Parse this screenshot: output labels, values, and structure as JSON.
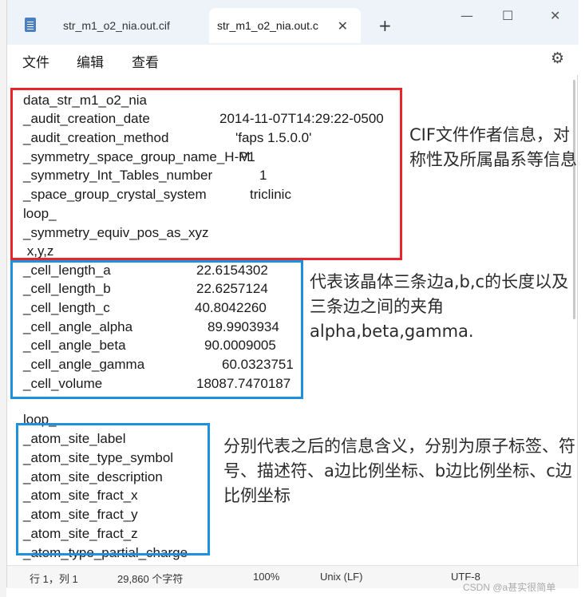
{
  "window": {
    "tabs": [
      {
        "label": "str_m1_o2_nia.out.cif"
      },
      {
        "label": "str_m1_o2_nia.out.c"
      }
    ],
    "new_tab_symbol": "+",
    "tab_close_symbol": "✕",
    "controls": {
      "minimize": "—",
      "maximize": "☐",
      "close": "✕"
    }
  },
  "menu": {
    "items": [
      "文件",
      "编辑",
      "查看"
    ],
    "settings_icon": "gear-icon"
  },
  "editor": {
    "lines": [
      {
        "key": "data_str_m1_o2_nia",
        "value": ""
      },
      {
        "key": "_audit_creation_date",
        "value": "2014-11-07T14:29:22-0500"
      },
      {
        "key": "_audit_creation_method",
        "value": "'faps 1.5.0.0'"
      },
      {
        "key": "_symmetry_space_group_name_H-M",
        "value": "P1"
      },
      {
        "key": "_symmetry_Int_Tables_number",
        "value": "1"
      },
      {
        "key": "_space_group_crystal_system",
        "value": "triclinic"
      },
      {
        "key": "loop_",
        "value": ""
      },
      {
        "key": "_symmetry_equiv_pos_as_xyz",
        "value": ""
      },
      {
        "key": " x,y,z",
        "value": ""
      },
      {
        "key": "_cell_length_a",
        "value": "22.6154302"
      },
      {
        "key": "_cell_length_b",
        "value": "22.6257124"
      },
      {
        "key": "_cell_length_c",
        "value": "40.8042260"
      },
      {
        "key": "_cell_angle_alpha",
        "value": "89.9903934"
      },
      {
        "key": "_cell_angle_beta",
        "value": "90.0009005"
      },
      {
        "key": "_cell_angle_gamma",
        "value": "60.0323751"
      },
      {
        "key": "_cell_volume",
        "value": "18087.7470187"
      },
      {
        "key": "loop_",
        "value": ""
      },
      {
        "key": "_atom_site_label",
        "value": ""
      },
      {
        "key": "_atom_site_type_symbol",
        "value": ""
      },
      {
        "key": "_atom_site_description",
        "value": ""
      },
      {
        "key": "_atom_site_fract_x",
        "value": ""
      },
      {
        "key": "_atom_site_fract_y",
        "value": ""
      },
      {
        "key": "_atom_site_fract_z",
        "value": ""
      },
      {
        "key": "_atom_type_partial_charge",
        "value": ""
      }
    ]
  },
  "annotations": {
    "red": "CIF文件作者信息，对称性及所属晶系等信息",
    "blue1": "代表该晶体三条边a,b,c的长度以及三条边之间的夹角alpha,beta,gamma.",
    "blue2": "分别代表之后的信息含义，分别为原子标签、符号、描述符、a边比例坐标、b边比例坐标、c边比例坐标",
    "colors": {
      "red": "#e8252a",
      "blue": "#1e90e0"
    }
  },
  "statusbar": {
    "position": "行 1，列 1",
    "chars": "29,860 个字符",
    "zoom": "100%",
    "line_ending": "Unix (LF)",
    "encoding": "UTF-8"
  },
  "watermark": "CSDN @a甚实很简单"
}
